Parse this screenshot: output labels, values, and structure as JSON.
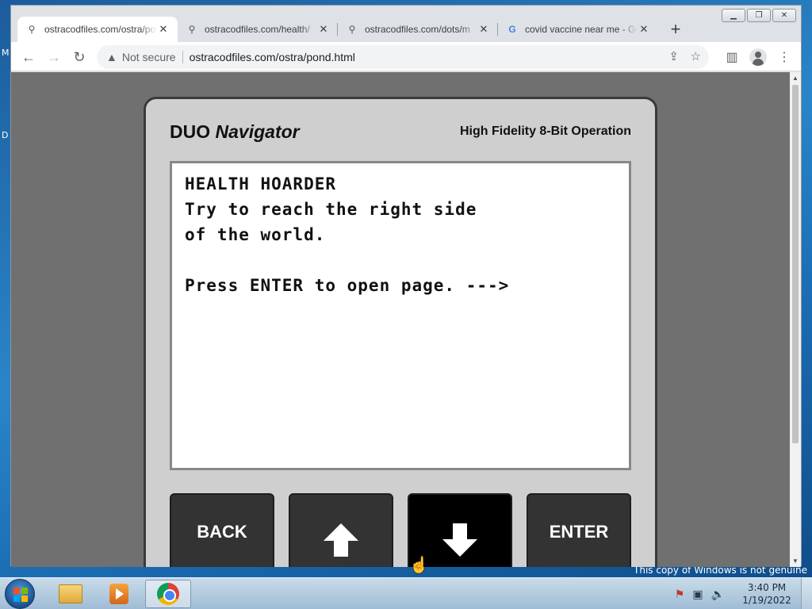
{
  "window": {
    "controls": [
      "▁",
      "❐",
      "✕"
    ]
  },
  "tabs": [
    {
      "title": "ostracodfiles.com/ostra/pond.html",
      "icon": "link-favicon",
      "active": true
    },
    {
      "title": "ostracodfiles.com/health/",
      "icon": "link-favicon",
      "active": false
    },
    {
      "title": "ostracodfiles.com/dots/m",
      "icon": "link-favicon",
      "active": false
    },
    {
      "title": "covid vaccine near me - Google Search",
      "icon": "google-favicon",
      "active": false
    }
  ],
  "toolbar": {
    "security_label": "Not secure",
    "url": "ostracodfiles.com/ostra/pond.html"
  },
  "device": {
    "brand": "DUO",
    "model": "Navigator",
    "tagline": "High Fidelity 8-Bit Operation",
    "screen_lines": [
      "HEALTH HOARDER",
      "Try to reach the right side",
      "of the world.",
      "",
      "Press ENTER to open page. --->"
    ],
    "keys": {
      "back": "BACK",
      "up": "up-arrow",
      "down": "down-arrow",
      "enter": "ENTER"
    }
  },
  "desktop": {
    "watermark": "This copy of Windows is not genuine"
  },
  "taskbar": {
    "time": "3:40 PM",
    "date": "1/19/2022"
  }
}
